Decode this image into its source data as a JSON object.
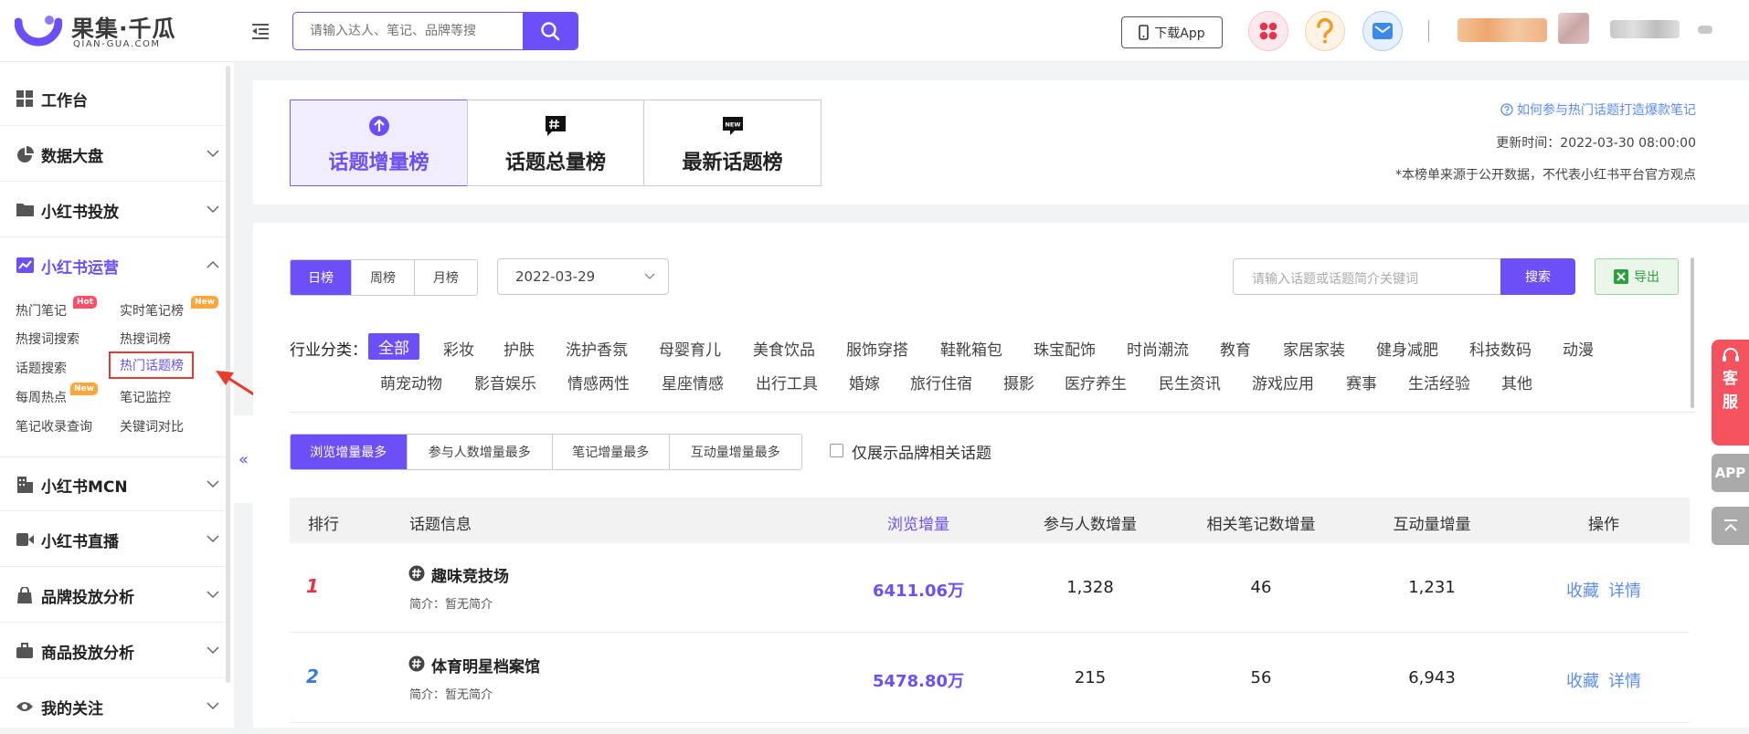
{
  "logo": {
    "cn": "果集·千瓜",
    "en": "QIAN-GUA.COM"
  },
  "header": {
    "search_placeholder": "请输入达人、笔记、品牌等搜",
    "download_label": "下载App"
  },
  "sidebar": {
    "sections": [
      {
        "label": "工作台",
        "icon": "dashboard-icon"
      },
      {
        "label": "数据大盘",
        "icon": "pie-chart-icon"
      },
      {
        "label": "小红书投放",
        "icon": "folder-icon"
      },
      {
        "label": "小红书运营",
        "icon": "trend-chart-icon"
      },
      {
        "label": "小红书MCN",
        "icon": "building-icon"
      },
      {
        "label": "小红书直播",
        "icon": "video-icon"
      },
      {
        "label": "品牌投放分析",
        "icon": "shopping-bag-icon"
      },
      {
        "label": "商品投放分析",
        "icon": "briefcase-icon"
      },
      {
        "label": "我的关注",
        "icon": "eye-icon"
      }
    ],
    "sub_items": [
      {
        "label": "热门笔记",
        "badge": "Hot"
      },
      {
        "label": "实时笔记榜",
        "badge": "New"
      },
      {
        "label": "热搜词搜索"
      },
      {
        "label": "热搜词榜"
      },
      {
        "label": "话题搜索"
      },
      {
        "label": "热门话题榜"
      },
      {
        "label": "每周热点",
        "badge": "New"
      },
      {
        "label": "笔记监控"
      },
      {
        "label": "笔记收录查询"
      },
      {
        "label": "关键词对比"
      }
    ],
    "collapse_glyph": "«"
  },
  "ranking_tabs": [
    {
      "label": "话题增量榜",
      "icon": "arrow-up-circle-icon"
    },
    {
      "label": "话题总量榜",
      "icon": "hashtag-bubble-icon"
    },
    {
      "label": "最新话题榜",
      "icon": "new-bubble-icon"
    }
  ],
  "info": {
    "help_link": "如何参与热门话题打造爆款笔记",
    "update_time": "更新时间：2022-03-30 08:00:00",
    "disclaimer": "*本榜单来源于公开数据，不代表小红书平台官方观点"
  },
  "period_tabs": [
    "日榜",
    "周榜",
    "月榜"
  ],
  "date_value": "2022-03-29",
  "keyword_search": {
    "placeholder": "请输入话题或话题简介关键词",
    "button": "搜索"
  },
  "export_label": "导出",
  "industry": {
    "label": "行业分类：",
    "row1": [
      "全部",
      "彩妆",
      "护肤",
      "洗护香氛",
      "母婴育儿",
      "美食饮品",
      "服饰穿搭",
      "鞋靴箱包",
      "珠宝配饰",
      "时尚潮流",
      "教育",
      "家居家装",
      "健身减肥",
      "科技数码",
      "动漫"
    ],
    "row2": [
      "萌宠动物",
      "影音娱乐",
      "情感两性",
      "星座情感",
      "出行工具",
      "婚嫁",
      "旅行住宿",
      "摄影",
      "医疗养生",
      "民生资讯",
      "游戏应用",
      "赛事",
      "生活经验",
      "其他"
    ]
  },
  "sort_tabs": [
    "浏览增量最多",
    "参与人数增量最多",
    "笔记增量最多",
    "互动量增量最多"
  ],
  "brand_only_label": "仅展示品牌相关话题",
  "table": {
    "headers": [
      "排行",
      "话题信息",
      "浏览增量",
      "参与人数增量",
      "相关笔记数增量",
      "互动量增量",
      "操作"
    ],
    "rows": [
      {
        "rank": "1",
        "name": "趣味竞技场",
        "desc": "简介：暂无简介",
        "views": "6411.06万",
        "participants": "1,328",
        "notes": "46",
        "interactions": "1,231",
        "fav": "收藏",
        "detail": "详情"
      },
      {
        "rank": "2",
        "name": "体育明星档案馆",
        "desc": "简介：暂无简介",
        "views": "5478.80万",
        "participants": "215",
        "notes": "56",
        "interactions": "6,943",
        "fav": "收藏",
        "detail": "详情"
      }
    ]
  },
  "floating": {
    "service": "客服",
    "app": "APP"
  },
  "colors": {
    "accent": "#6c4ff6",
    "rank1": "#e5343f",
    "rank2": "#3a7bd5",
    "link": "#5b8df5",
    "service": "#f4525f"
  }
}
